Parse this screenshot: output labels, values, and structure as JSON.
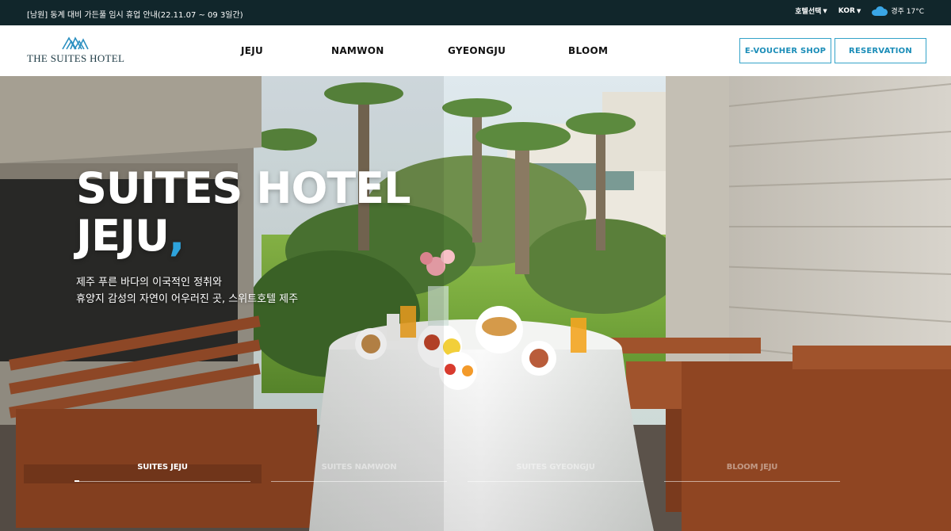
{
  "topbar": {
    "notice": "[남원] 동계 대비 가든풀 임시 휴업 안내(22.11.07 ~ 09 3일간)",
    "hotel_select": "호텔선택",
    "language": "KOR",
    "weather_icon": "cloud-icon",
    "weather": "경주 17°C"
  },
  "header": {
    "logo_text": "THE SUITES HOTEL",
    "nav": [
      "JEJU",
      "NAMWON",
      "GYEONGJU",
      "BLOOM"
    ],
    "voucher_button": "E-VOUCHER SHOP",
    "reservation_button": "RESERVATION"
  },
  "hero": {
    "title_line1": "SUITES HOTEL",
    "title_line2": "JEJU",
    "title_dot": ",",
    "subtitle_line1": "제주 푸른 바다의 이국적인 정취와",
    "subtitle_line2": "휴양지 감성의 자연이 어우러진 곳, 스위트호텔 제주",
    "tabs": [
      {
        "label": "SUITES JEJU",
        "active": true
      },
      {
        "label": "SUITES NAMWON",
        "active": false
      },
      {
        "label": "SUITES GYEONGJU",
        "active": false
      },
      {
        "label": "BLOOM JEJU",
        "active": false
      }
    ]
  },
  "colors": {
    "topbar_bg": "#11262b",
    "accent": "#2ea3dc",
    "button_border": "#34a3c9"
  }
}
